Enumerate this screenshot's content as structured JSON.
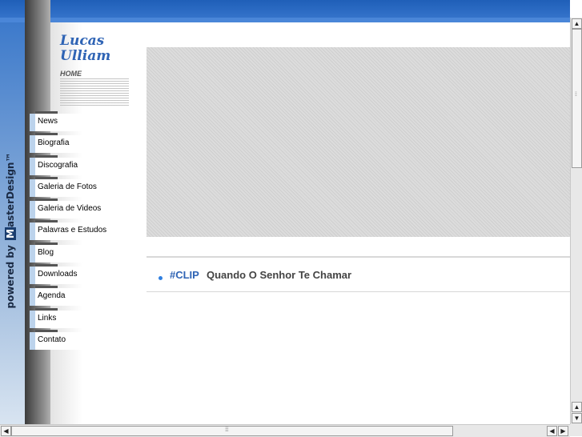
{
  "header": {
    "accent_color": "#2f64b5"
  },
  "powered_by": {
    "prefix": "powered by ",
    "mark": "M",
    "suffix": "asterDesign™"
  },
  "logo": {
    "line1": "Lucas",
    "line2": "Ulliam"
  },
  "home_label": "HOME",
  "nav": {
    "items": [
      {
        "label": "News"
      },
      {
        "label": "Biografia"
      },
      {
        "label": "Discografia"
      },
      {
        "label": "Galeria de Fotos"
      },
      {
        "label": "Galeria de Videos"
      },
      {
        "label": "Palavras e Estudos"
      },
      {
        "label": "Blog"
      },
      {
        "label": "Downloads"
      },
      {
        "label": "Agenda"
      },
      {
        "label": "Links"
      },
      {
        "label": "Contato"
      }
    ]
  },
  "featured": {
    "tag": "#CLIP",
    "title": "Quando O Senhor Te Chamar"
  },
  "scrollbars": {
    "vertical_icon_up": "up-arrow-icon",
    "vertical_icon_down": "down-arrow-icon",
    "horizontal_icon_left": "left-arrow-icon",
    "horizontal_icon_right": "right-arrow-icon"
  }
}
